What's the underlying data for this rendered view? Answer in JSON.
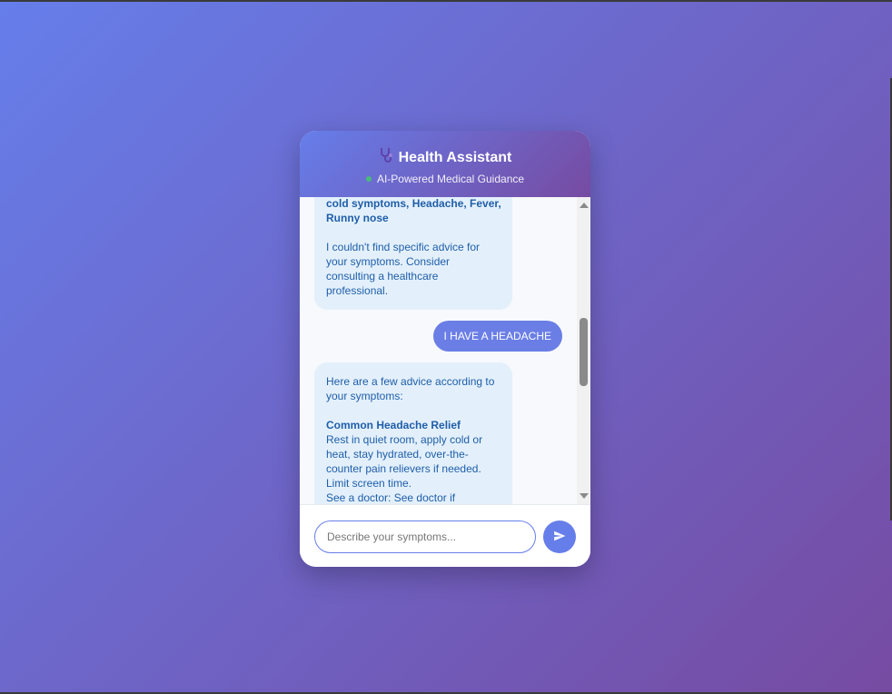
{
  "header": {
    "icon": "stethoscope-icon",
    "title": "Health Assistant",
    "subtitle": "AI-Powered Medical Guidance",
    "status_color": "#48bb78"
  },
  "messages": [
    {
      "role": "bot",
      "lines_bold": "cold symptoms, Headache, Fever, Runny nose",
      "text": "I couldn't find specific advice for your symptoms. Consider consulting a healthcare professional."
    },
    {
      "role": "user",
      "text": "I HAVE A HEADACHE"
    },
    {
      "role": "bot",
      "intro": "Here are a few advice according to your symptoms:",
      "heading": "Common Headache Relief",
      "body": "Rest in quiet room, apply cold or heat, stay hydrated, over-the-counter pain relievers if needed. Limit screen time.",
      "doctor": "See a doctor: See doctor if headaches become frequent, severe, or interfere with daily activities."
    }
  ],
  "input": {
    "placeholder": "Describe your symptoms..."
  },
  "send_button": {
    "icon": "send-icon"
  },
  "colors": {
    "accent": "#667eea",
    "accent_dark": "#764ba2",
    "bot_bubble": "#e3f0fc",
    "bot_text": "#1f5ea8"
  }
}
